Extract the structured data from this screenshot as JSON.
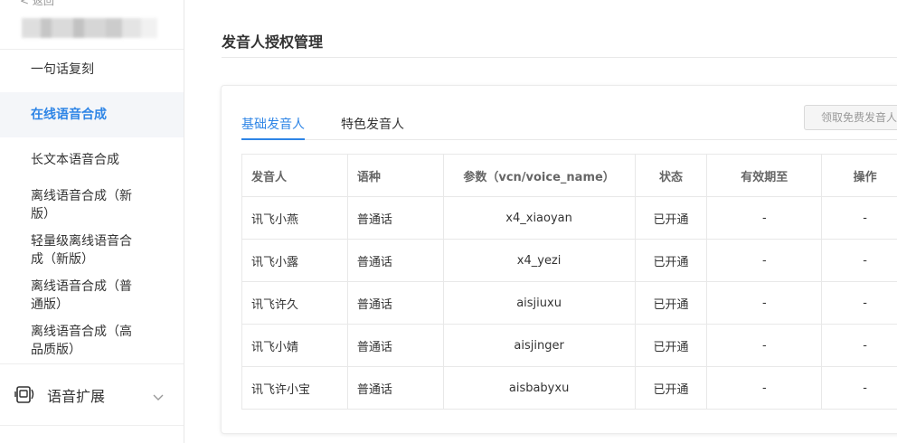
{
  "sidebar": {
    "back_label": "< 返回",
    "items": [
      {
        "label": "一句话复刻"
      },
      {
        "label": "在线语音合成"
      },
      {
        "label": "长文本语音合成"
      },
      {
        "label": "离线语音合成（新版）"
      },
      {
        "label": "轻量级离线语音合成（新版）"
      },
      {
        "label": "离线语音合成（普通版）"
      },
      {
        "label": "离线语音合成（高品质版）"
      }
    ],
    "active_index": 1,
    "group": {
      "label": "语音扩展",
      "icon": "voice-extension-icon"
    }
  },
  "main": {
    "title": "发音人授权管理",
    "tabs": [
      {
        "label": "基础发音人"
      },
      {
        "label": "特色发音人"
      }
    ],
    "free_button": "领取免费发音人",
    "table": {
      "headers": [
        "发音人",
        "语种",
        "参数（vcn/voice_name）",
        "状态",
        "有效期至",
        "操作"
      ],
      "rows": [
        [
          "讯飞小燕",
          "普通话",
          "x4_xiaoyan",
          "已开通",
          "-",
          "-"
        ],
        [
          "讯飞小露",
          "普通话",
          "x4_yezi",
          "已开通",
          "-",
          "-"
        ],
        [
          "讯飞许久",
          "普通话",
          "aisjiuxu",
          "已开通",
          "-",
          "-"
        ],
        [
          "讯飞小婧",
          "普通话",
          "aisjinger",
          "已开通",
          "-",
          "-"
        ],
        [
          "讯飞许小宝",
          "普通话",
          "aisbabyxu",
          "已开通",
          "-",
          "-"
        ]
      ]
    }
  },
  "colors": {
    "accent": "#2e85e6",
    "active_bg": "#f4f6f9"
  }
}
